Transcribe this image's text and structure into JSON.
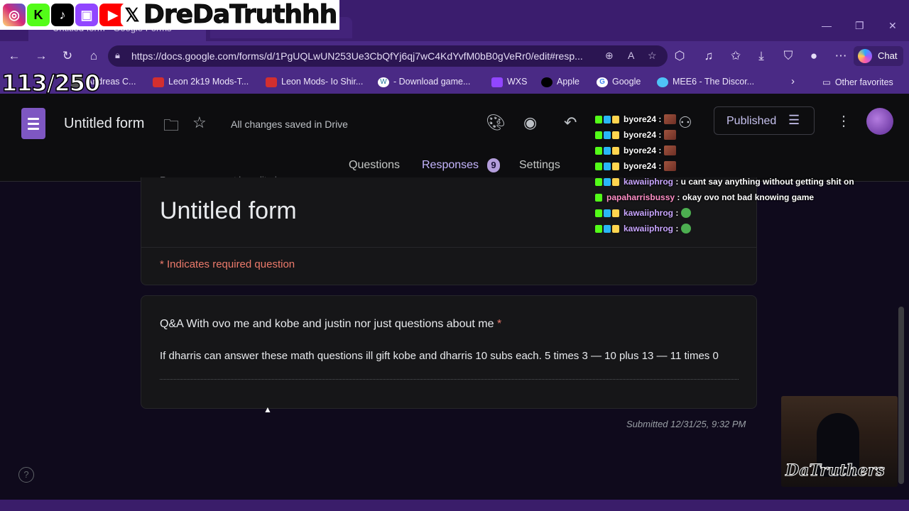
{
  "browser": {
    "tab_title": "Untitled form - Google Forms",
    "url": "https://docs.google.com/forms/d/1PgUQLwUN253Ue3CbQfYj6qj7wC4KdYvfM0bB0gVeRr0/edit#resp...",
    "chat_label": "Chat",
    "bookmarks": [
      {
        "label": "Andreas C...",
        "icon": "video-icon"
      },
      {
        "label": "Leon 2k19 Mods-T...",
        "icon": "folder-icon"
      },
      {
        "label": "Leon Mods- Io Shir...",
        "icon": "folder-icon"
      },
      {
        "label": "- Download game...",
        "icon": "wordpress-icon"
      },
      {
        "label": "WXS",
        "icon": "twitch-icon"
      },
      {
        "label": "Apple",
        "icon": "apple-icon"
      },
      {
        "label": "Google",
        "icon": "google-icon"
      },
      {
        "label": "MEE6 - The Discor...",
        "icon": "mee6-icon"
      }
    ],
    "other_favorites": "Other favorites"
  },
  "overlay": {
    "handle": "DreDaTruthhh",
    "counter": "113/250"
  },
  "app": {
    "form_name": "Untitled form",
    "save_status": "All changes saved in Drive",
    "published_label": "Published",
    "tabs": {
      "questions": "Questions",
      "responses": "Responses",
      "responses_count": "9",
      "settings": "Settings"
    }
  },
  "form": {
    "cut_notice": "Responses cannot be edited",
    "title": "Untitled form",
    "required_note": "* Indicates required question",
    "question": "Q&A With ovo me and kobe and justin nor just questions about me",
    "required_star": "*",
    "answer": "If dharris can answer these math questions ill gift kobe and dharris 10 subs each.  5 times 3 — 10 plus 13 — 11 times 0",
    "submitted": "Submitted 12/31/25, 9:32 PM"
  },
  "chat": [
    {
      "user": "byore24",
      "sep": " :",
      "msg": "",
      "emote": "brown",
      "user_color": "#ffffff"
    },
    {
      "user": "byore24",
      "sep": " :",
      "msg": "",
      "emote": "brown",
      "user_color": "#ffffff"
    },
    {
      "user": "byore24",
      "sep": " :",
      "msg": "",
      "emote": "brown",
      "user_color": "#ffffff"
    },
    {
      "user": "byore24",
      "sep": " :",
      "msg": "",
      "emote": "brown",
      "user_color": "#ffffff"
    },
    {
      "user": "kawaiiphrog",
      "sep": " :",
      "msg": " u cant say anything without getting shit on",
      "emote": "",
      "user_color": "#c9a6ff"
    },
    {
      "user": "papaharrisbussy",
      "sep": " :",
      "msg": " okay ovo not bad knowing game",
      "emote": "",
      "user_color": "#ff8fc7"
    },
    {
      "user": "kawaiiphrog",
      "sep": " :",
      "msg": "",
      "emote": "green",
      "user_color": "#c9a6ff"
    },
    {
      "user": "kawaiiphrog",
      "sep": " :",
      "msg": "",
      "emote": "green",
      "user_color": "#c9a6ff"
    }
  ],
  "webcam": {
    "logo": "DaTruthers"
  },
  "colors": {
    "accent": "#b39ddb",
    "browser": "#4a2a85",
    "required": "#ec7a6b"
  }
}
